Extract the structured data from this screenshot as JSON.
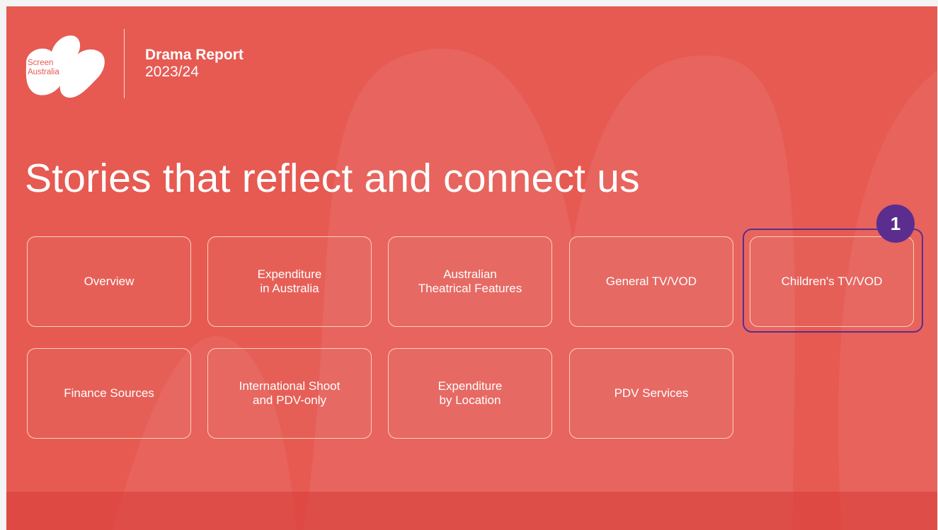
{
  "logo": {
    "line1": "Screen",
    "line2": "Australia"
  },
  "report": {
    "title": "Drama Report",
    "year": "2023/24"
  },
  "headline": "Stories that reflect and connect us",
  "tiles": [
    {
      "label": "Overview"
    },
    {
      "label": "Expenditure\nin Australia"
    },
    {
      "label": "Australian\nTheatrical Features"
    },
    {
      "label": "General TV/VOD"
    },
    {
      "label": "Children's TV/VOD"
    },
    {
      "label": "Finance Sources"
    },
    {
      "label": "International Shoot\nand PDV-only"
    },
    {
      "label": "Expenditure\nby Location"
    },
    {
      "label": "PDV Services"
    }
  ],
  "marker": {
    "number": "1"
  },
  "colors": {
    "background": "#e65a52",
    "marker": "#5b2d8e",
    "tile_border": "#ffe4c8"
  }
}
